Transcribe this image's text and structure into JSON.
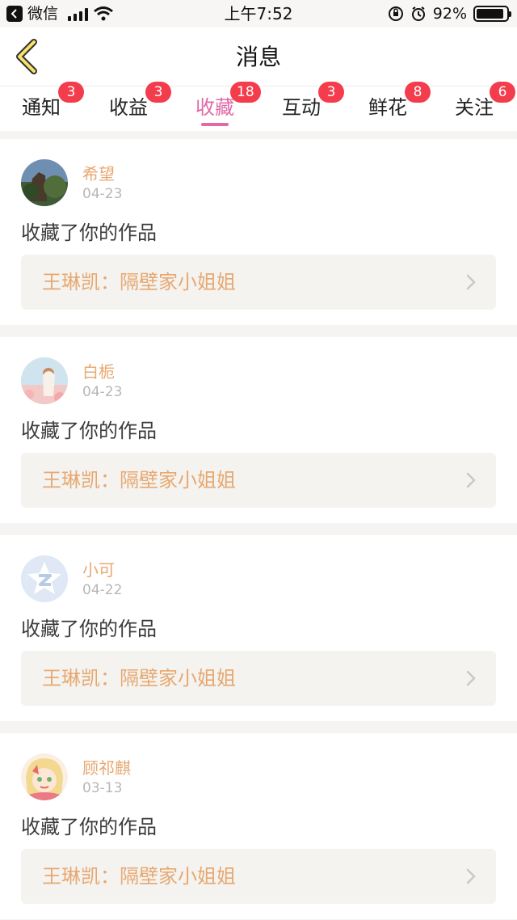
{
  "status_bar": {
    "app_name": "微信",
    "time": "上午7:52",
    "battery": "92%",
    "battery_level": 0.92
  },
  "header": {
    "title": "消息"
  },
  "tabs": [
    {
      "label": "通知",
      "badge": "3",
      "active": false
    },
    {
      "label": "收益",
      "badge": "3",
      "active": false
    },
    {
      "label": "收藏",
      "badge": "18",
      "active": true
    },
    {
      "label": "互动",
      "badge": "3",
      "active": false
    },
    {
      "label": "鲜花",
      "badge": "8",
      "active": false
    },
    {
      "label": "关注",
      "badge": "6",
      "active": false
    }
  ],
  "items": [
    {
      "name": "希望",
      "date": "04-23",
      "action": "收藏了你的作品",
      "work": "王琳凯：隔壁家小姐姐",
      "avatar_icon": "landscape-avatar"
    },
    {
      "name": "白栀",
      "date": "04-23",
      "action": "收藏了你的作品",
      "work": "王琳凯：隔壁家小姐姐",
      "avatar_icon": "girl-photo-avatar"
    },
    {
      "name": "小可",
      "date": "04-22",
      "action": "收藏了你的作品",
      "work": "王琳凯：隔壁家小姐姐",
      "avatar_icon": "default-star-avatar"
    },
    {
      "name": "顾祁麒",
      "date": "03-13",
      "action": "收藏了你的作品",
      "work": "王琳凯：隔壁家小姐姐",
      "avatar_icon": "anime-girl-avatar"
    }
  ],
  "colors": {
    "accent_pink": "#e06aa6",
    "badge_red": "#f33c4c",
    "username_orange": "#e7a872"
  }
}
